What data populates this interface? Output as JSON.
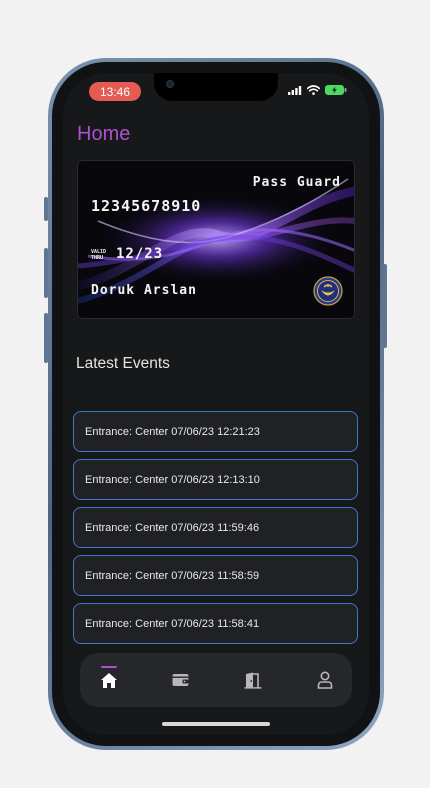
{
  "status_bar": {
    "time": "13:46",
    "icons": [
      "signal-icon",
      "wifi-icon",
      "battery-charging-icon"
    ],
    "time_pill_color": "#e35b52"
  },
  "header": {
    "title": "Home",
    "title_color": "#b04fd0"
  },
  "card": {
    "brand": "Pass Guard",
    "number": "12345678910",
    "valid_label": "VALID THRU",
    "expiry": "12/23",
    "holder": "Doruk Arslan",
    "seal_icon": "university-seal-icon"
  },
  "events_section": {
    "title": "Latest Events",
    "items": [
      "Entrance: Center 07/06/23 12:21:23",
      "Entrance: Center 07/06/23 12:13:10",
      "Entrance: Center 07/06/23 11:59:46",
      "Entrance: Center 07/06/23 11:58:59",
      "Entrance: Center 07/06/23 11:58:41"
    ],
    "border_color": "#3e78c4"
  },
  "tab_bar": {
    "tabs": [
      {
        "name": "home",
        "icon": "home-icon",
        "active": true
      },
      {
        "name": "wallet",
        "icon": "wallet-icon",
        "active": false
      },
      {
        "name": "door",
        "icon": "door-icon",
        "active": false
      },
      {
        "name": "profile",
        "icon": "person-icon",
        "active": false
      }
    ],
    "accent_color": "#b04fd0"
  }
}
